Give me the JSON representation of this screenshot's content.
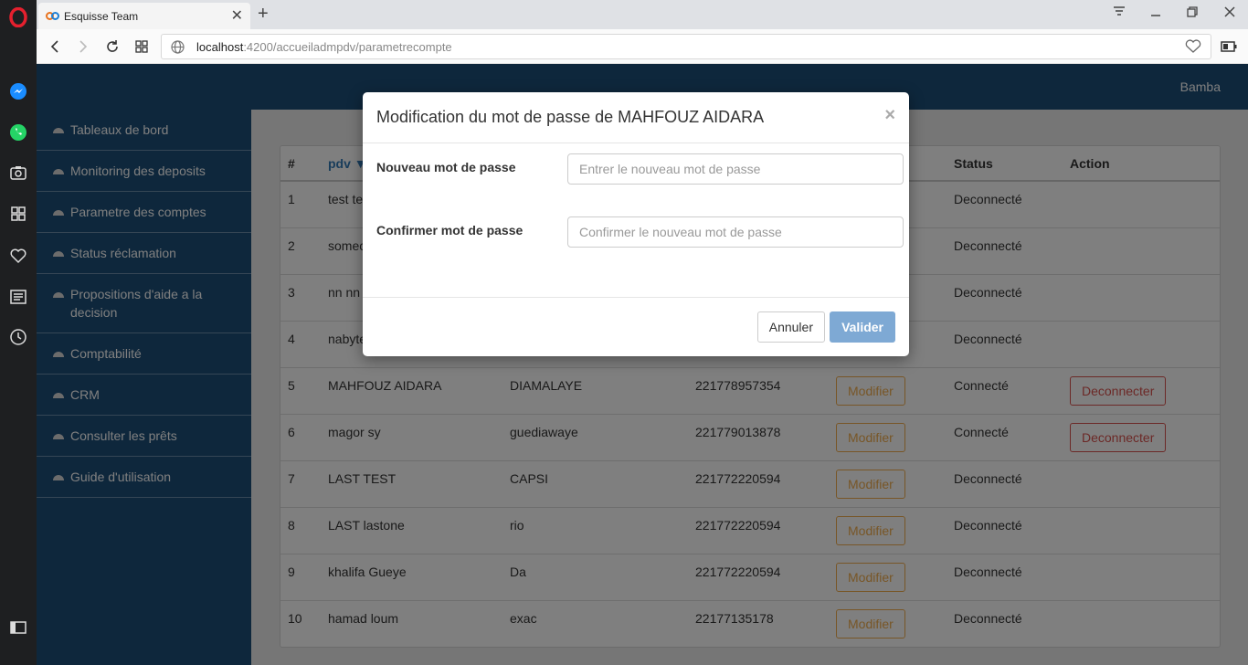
{
  "browser": {
    "tab_title": "Esquisse Team",
    "url_host": "localhost",
    "url_rest": ":4200/accueiladmpdv/parametrecompte"
  },
  "header": {
    "user": "Bamba"
  },
  "sidebar": {
    "items": [
      {
        "label": "Tableaux de bord"
      },
      {
        "label": "Monitoring des deposits"
      },
      {
        "label": "Parametre des comptes"
      },
      {
        "label": "Status réclamation"
      },
      {
        "label": "Propositions d'aide a la decision"
      },
      {
        "label": "Comptabilité"
      },
      {
        "label": "CRM"
      },
      {
        "label": "Consulter les prêts"
      },
      {
        "label": "Guide d'utilisation"
      }
    ]
  },
  "table": {
    "headers": {
      "num": "#",
      "pdv": "pdv",
      "status": "Status",
      "action": "Action"
    },
    "rows": [
      {
        "num": "1",
        "pdv": "test te",
        "col3": "",
        "phone": "",
        "status": "Deconnecté",
        "action": ""
      },
      {
        "num": "2",
        "pdv": "somec",
        "col3": "",
        "phone": "",
        "status": "Deconnecté",
        "action": ""
      },
      {
        "num": "3",
        "pdv": "nn nn",
        "col3": "",
        "phone": "",
        "status": "Deconnecté",
        "action": ""
      },
      {
        "num": "4",
        "pdv": "nabyte",
        "col3": "",
        "phone": "",
        "status": "Deconnecté",
        "action": ""
      },
      {
        "num": "5",
        "pdv": "MAHFOUZ AIDARA",
        "col3": "DIAMALAYE",
        "phone": "221778957354",
        "modify": "Modifier",
        "status": "Connecté",
        "action": "Deconnecter"
      },
      {
        "num": "6",
        "pdv": "magor sy",
        "col3": "guediawaye",
        "phone": "221779013878",
        "modify": "Modifier",
        "status": "Connecté",
        "action": "Deconnecter"
      },
      {
        "num": "7",
        "pdv": "LAST TEST",
        "col3": "CAPSI",
        "phone": "221772220594",
        "modify": "Modifier",
        "status": "Deconnecté",
        "action": ""
      },
      {
        "num": "8",
        "pdv": "LAST lastone",
        "col3": "rio",
        "phone": "221772220594",
        "modify": "Modifier",
        "status": "Deconnecté",
        "action": ""
      },
      {
        "num": "9",
        "pdv": "khalifa Gueye",
        "col3": "Da",
        "phone": "221772220594",
        "modify": "Modifier",
        "status": "Deconnecté",
        "action": ""
      },
      {
        "num": "10",
        "pdv": "hamad loum",
        "col3": "exac",
        "phone": "22177135178",
        "modify": "Modifier",
        "status": "Deconnecté",
        "action": ""
      }
    ]
  },
  "modal": {
    "title": "Modification du mot de passe de MAHFOUZ AIDARA",
    "close": "×",
    "new_password_label": "Nouveau mot de passe",
    "new_password_placeholder": "Entrer le nouveau mot de passe",
    "confirm_label": "Confirmer mot de passe",
    "confirm_placeholder": "Confirmer le nouveau mot de passe",
    "cancel": "Annuler",
    "submit": "Valider"
  },
  "colors": {
    "brand": "#1d4e78",
    "warning": "#f0ad4e",
    "danger": "#d9534f",
    "primary_disabled": "#7ea9d4"
  }
}
